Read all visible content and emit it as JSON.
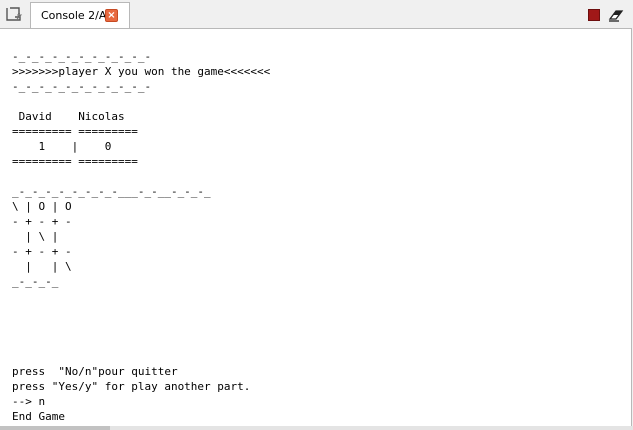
{
  "tabbar": {
    "tab_label": "Console 2/A",
    "tab_close_glyph": "×",
    "icons": {
      "new": "new-console-icon",
      "close": "close-icon",
      "stop": "stop-icon",
      "clear": "eraser-icon"
    }
  },
  "colors": {
    "close_button": "#e8693f",
    "stop_button": "#a01818",
    "background": "#ffffff"
  },
  "console": {
    "output": "-_-_-_-_-_-_-_-_-_-_-\n>>>>>>>player X you won the game<<<<<<<\n-_-_-_-_-_-_-_-_-_-_-\n\n David    Nicolas\n========= =========\n    1    |    0\n========= =========\n\n_-_-_-_-_-_-_-_-___-_-__-_-_-_\n\\ | O | O\n- + - + -\n  | \\ |\n- + - + -\n  |   | \\\n_-_-_-_\n\n\n\n\n\npress  \"No/n\"pour quitter\npress \"Yes/y\" for play another part.\n--> n\nEnd Game"
  }
}
